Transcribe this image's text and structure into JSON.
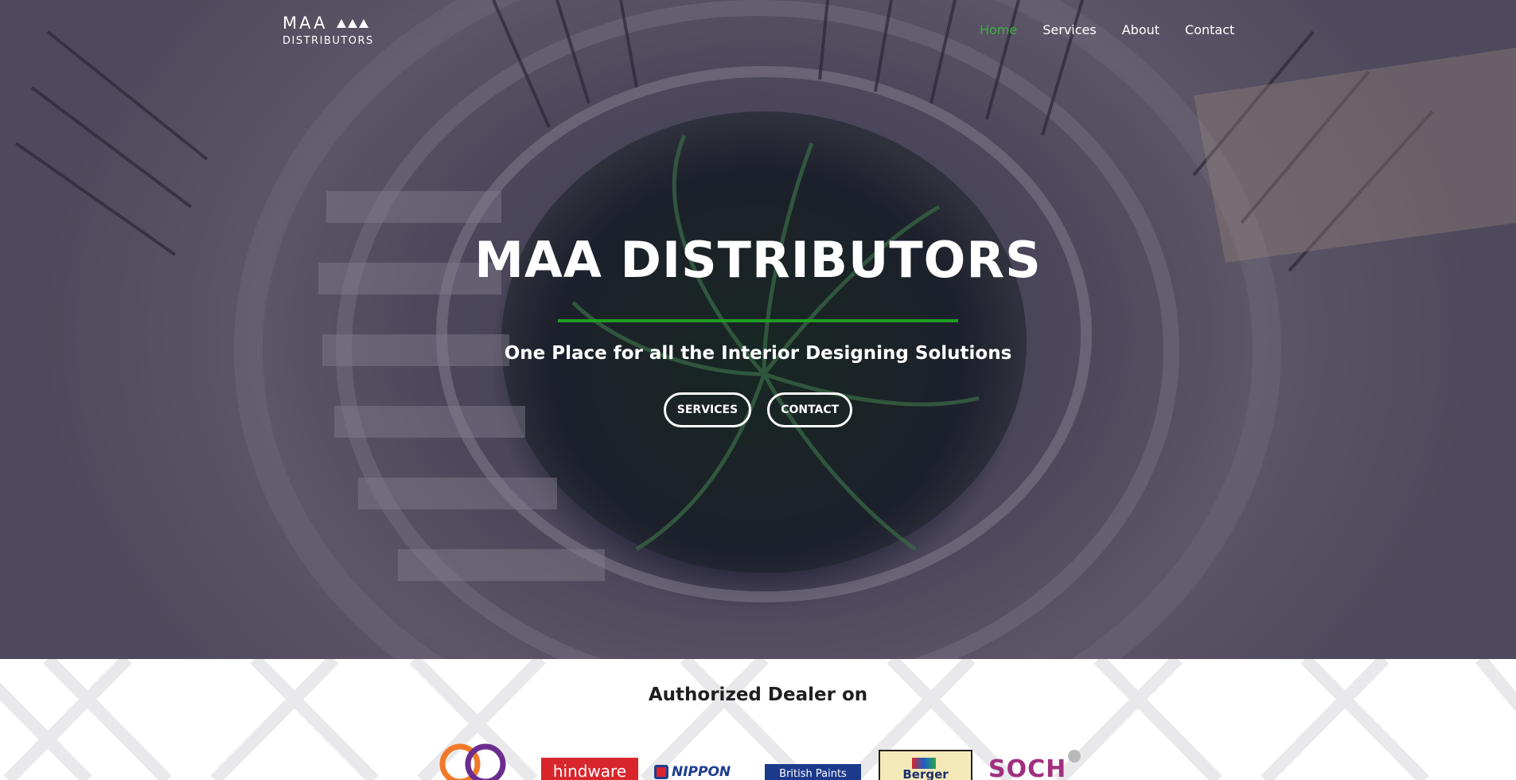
{
  "logo": {
    "line1": "MAA",
    "line2": "DISTRIBUTORS"
  },
  "nav": {
    "items": [
      {
        "label": "Home",
        "active": true
      },
      {
        "label": "Services",
        "active": false
      },
      {
        "label": "About",
        "active": false
      },
      {
        "label": "Contact",
        "active": false
      }
    ]
  },
  "hero": {
    "title": "MAA DISTRIBUTORS",
    "subtitle": "One Place for all the Interior Designing Solutions",
    "buttons": [
      {
        "label": "SERVICES"
      },
      {
        "label": "CONTACT"
      }
    ]
  },
  "dealers": {
    "title": "Authorized Dealer on",
    "brands": [
      {
        "name": "ap-logo",
        "text": ""
      },
      {
        "name": "hindware-logo",
        "text": "hindware"
      },
      {
        "name": "nippon-logo",
        "text": "NIPPON"
      },
      {
        "name": "british-paints-logo",
        "text": "British Paints"
      },
      {
        "name": "berger-logo",
        "text": "Berger"
      },
      {
        "name": "soch-logo",
        "text": "SOCH"
      }
    ]
  },
  "colors": {
    "accent_green": "#3cb043",
    "rule_green": "#1f9d22",
    "hero_text": "#ffffff"
  }
}
